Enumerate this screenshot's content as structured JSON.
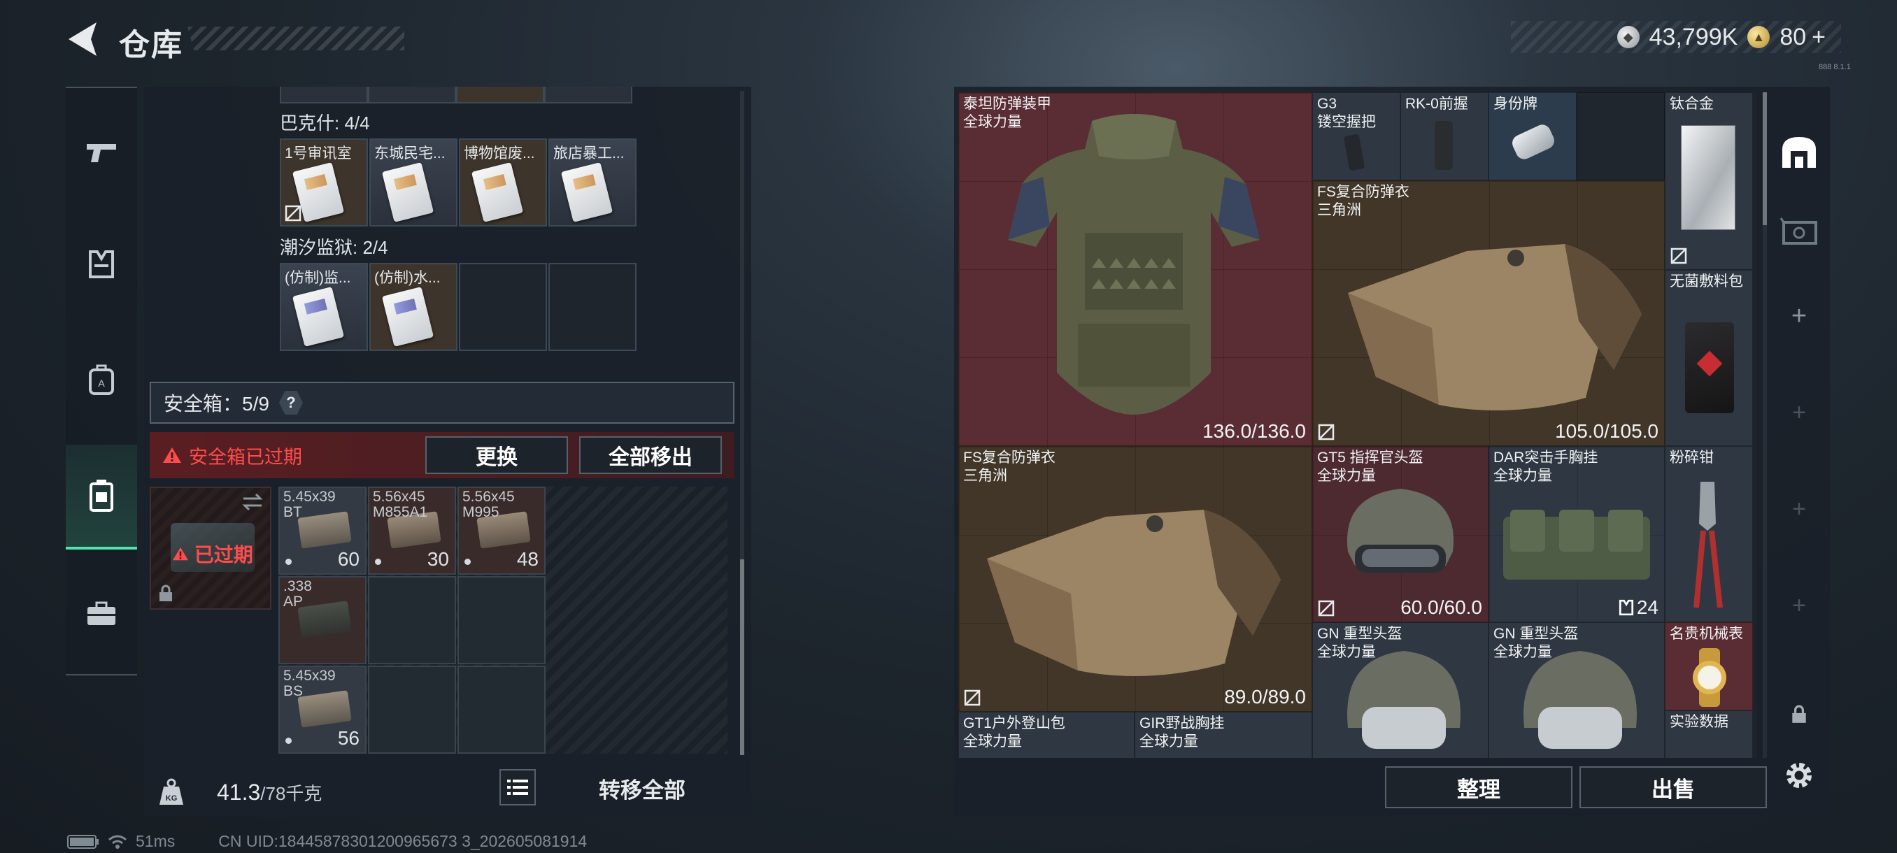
{
  "header": {
    "title": "仓库",
    "currency_main": "43,799K",
    "currency_premium": "80",
    "premium_plus": "+",
    "version": "888 8.1.1"
  },
  "left_panel": {
    "group1_label": "巴克什: 4/4",
    "group1_items": [
      "1号审讯室",
      "东城民宅...",
      "博物馆废...",
      "旅店暴工..."
    ],
    "group2_label": "潮汐监狱: 2/4",
    "group2_items": [
      "(仿制)监...",
      "(仿制)水..."
    ],
    "safe_box_label": "安全箱：5/9",
    "help_icon_text": "?",
    "alert_text": "安全箱已过期",
    "replace_button": "更换",
    "move_all_button": "全部移出",
    "expired_label": "已过期",
    "ammo": [
      {
        "name": "5.45x39\nBT",
        "count": "60"
      },
      {
        "name": "5.56x45\nM855A1",
        "count": "30"
      },
      {
        "name": "5.56x45\nM995",
        "count": "48"
      },
      {
        "name": ".338\nAP",
        "count": ""
      },
      {
        "name": "5.45x39\nBS",
        "count": "56"
      }
    ],
    "weight_current": "41.3",
    "weight_max": "/78千克",
    "transfer_all_button": "转移全部"
  },
  "right_panel": {
    "items": [
      {
        "name": "泰坦防弹装甲\n全球力量",
        "durability": "136.0/136.0"
      },
      {
        "name": "G3\n镂空握把",
        "durability": ""
      },
      {
        "name": "RK-0前握",
        "durability": ""
      },
      {
        "name": "身份牌",
        "durability": ""
      },
      {
        "name": "钛合金",
        "durability": ""
      },
      {
        "name": "FS复合防弹衣\n三角洲",
        "durability": "105.0/105.0"
      },
      {
        "name": "无菌敷料包",
        "durability": ""
      },
      {
        "name": "FS复合防弹衣\n三角洲",
        "durability": "89.0/89.0"
      },
      {
        "name": "GT5 指挥官头盔\n全球力量",
        "durability": "60.0/60.0"
      },
      {
        "name": "DAR突击手胸挂\n全球力量",
        "durability": "24"
      },
      {
        "name": "粉碎钳",
        "durability": ""
      },
      {
        "name": "GN 重型头盔\n全球力量",
        "durability": ""
      },
      {
        "name": "GN 重型头盔\n全球力量",
        "durability": ""
      },
      {
        "name": "名贵机械表",
        "durability": ""
      },
      {
        "name": "GT1户外登山包\n全球力量",
        "durability": ""
      },
      {
        "name": "GIR野战胸挂\n全球力量",
        "durability": ""
      },
      {
        "name": "实验数据",
        "durability": ""
      }
    ],
    "sort_button": "整理",
    "sell_button": "出售"
  },
  "status_bar": {
    "ping": "51ms",
    "uid": "CN UID:18445878301200965673 3_202605081914"
  },
  "colors": {
    "accent": "#4fe3b0",
    "alert": "#ff4b4b",
    "red_rarity": "#5a2d34",
    "gold_rarity": "#423628"
  }
}
